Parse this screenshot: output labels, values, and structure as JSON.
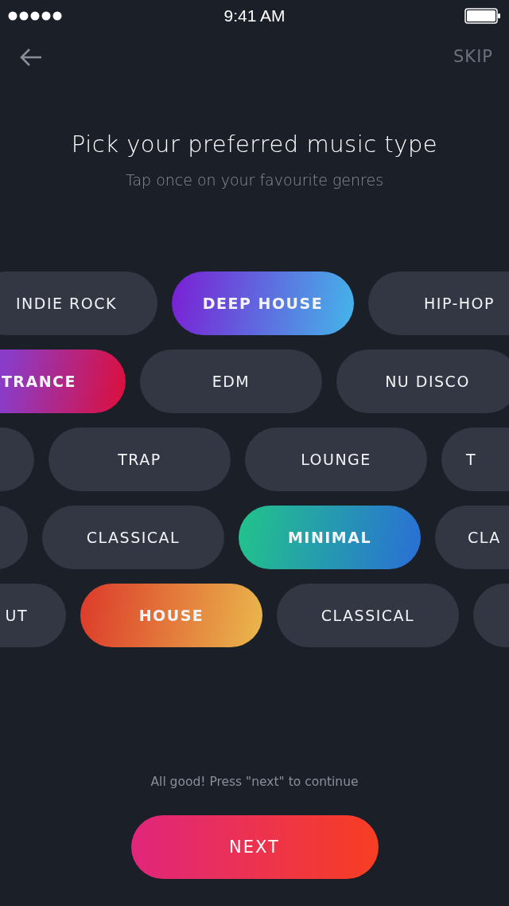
{
  "status_bar": {
    "time": "9:41 AM"
  },
  "nav": {
    "skip": "SKIP"
  },
  "title": "Pick your preferred music type",
  "subtitle": "Tap once on your favourite genres",
  "rows": [
    {
      "pills": [
        {
          "label": "INDIE ROCK",
          "selected": false
        },
        {
          "label": "DEEP HOUSE",
          "selected": true,
          "color": "#7a1fd4"
        },
        {
          "label": "HIP-HOP",
          "selected": false
        }
      ]
    },
    {
      "pills": [
        {
          "label": "TRANCE",
          "selected": true,
          "color": "#8a3cc8"
        },
        {
          "label": "EDM",
          "selected": false
        },
        {
          "label": "NU DISCO",
          "selected": false
        }
      ]
    },
    {
      "pills": [
        {
          "selected": false
        },
        {
          "label": "TRAP",
          "selected": false
        },
        {
          "label": "LOUNGE",
          "selected": false
        },
        {
          "label": "T",
          "selected": false
        }
      ]
    },
    {
      "pills": [
        {
          "selected": false
        },
        {
          "label": "CLASSICAL",
          "selected": false
        },
        {
          "label": "MINIMAL",
          "selected": true,
          "color": "#22c48a"
        },
        {
          "label": "CLA",
          "selected": false
        }
      ]
    },
    {
      "pills": [
        {
          "label": "UT",
          "selected": false
        },
        {
          "label": "HOUSE",
          "selected": true,
          "color": "#dc3a2a"
        },
        {
          "label": "CLASSICAL",
          "selected": false
        },
        {
          "selected": false
        }
      ]
    }
  ],
  "hint": "All good! Press \"next\" to continue",
  "next_button": "NEXT"
}
